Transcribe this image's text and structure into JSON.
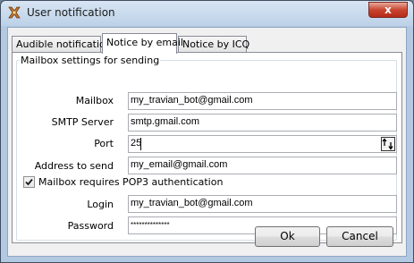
{
  "window": {
    "title": "User notification",
    "close_glyph": "x"
  },
  "tabs": [
    {
      "label": "Audible notification"
    },
    {
      "label": "Notice by email"
    },
    {
      "label": "Notice by ICQ"
    }
  ],
  "group": {
    "caption": "Mailbox settings for sending",
    "mailbox": {
      "label": "Mailbox",
      "value": "my_travian_bot@gmail.com"
    },
    "smtp": {
      "label": "SMTP Server",
      "value": "smtp.gmail.com"
    },
    "port": {
      "label": "Port",
      "value": "25"
    },
    "address": {
      "label": "Address to send",
      "value": "my_email@gmail.com"
    },
    "pop3": {
      "label": "Mailbox requires POP3 authentication",
      "checked": true
    },
    "login": {
      "label": "Login",
      "value": "my_travian_bot@gmail.com"
    },
    "password": {
      "label": "Password",
      "value": "**************"
    }
  },
  "buttons": {
    "ok": "Ok",
    "cancel": "Cancel"
  }
}
